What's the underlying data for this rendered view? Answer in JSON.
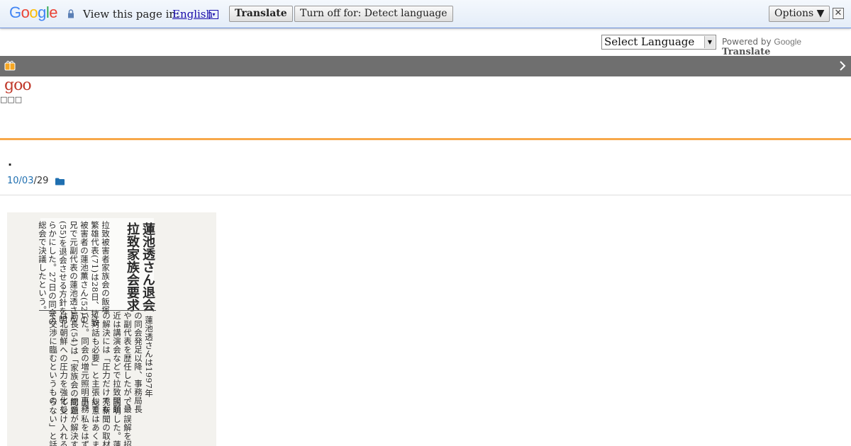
{
  "translate_bar": {
    "view_label": "View this page in:",
    "language": "English",
    "language_arrow": "▾",
    "translate_button": "Translate",
    "turn_off_button": "Turn off for: Detect language",
    "options_button": "Options ▼",
    "close": "✕"
  },
  "language_row": {
    "select_label": "Select Language",
    "select_arrow": "▼",
    "powered_by": "Powered by",
    "google": "Google",
    "translate": "Translate"
  },
  "blog": {
    "logo": "goo",
    "subtitle": "□□□",
    "chevron": "›"
  },
  "post": {
    "marker": ".",
    "date_link": "10/03",
    "date_suffix": "/29"
  },
  "clipping": {
    "headline_1": "蓮池透さん退会",
    "headline_2": "拉致家族会要求",
    "body_columns": [
      "拉致被害者家族会の飯塚",
      "繁雄代表(71)は28日、拉致",
      "被害者の蓮池薫さん(52)の",
      "兄で元副代表の蓮池透さん",
      "(55)を退会させる方針を明",
      "らかにした。27日の同会の",
      "総会で決議したという。"
    ],
    "body_columns_2": [
      "蓮池透さんは1997年",
      "の同会発足以降、事務局長",
      "や副代表を歴任したが、最",
      "近は講演会などで拉致問題",
      "の解決には「圧力だけでな",
      "く対話も必要」と主張して",
      "いた。同会の増元照明事務",
      "局長(54)は「家族会の総意",
      "は北朝鮮への圧力を強化し",
      "て交渉に臨むというもの"
    ],
    "body_columns_3": [
      "で、誤解を招く",
      "説明した。蓮池",
      "売新聞の取材に",
      "総意はあくまで",
      "出。私をはずす",
      "問題が解決する",
      "て受け入れるが",
      "らない」と話し"
    ]
  }
}
